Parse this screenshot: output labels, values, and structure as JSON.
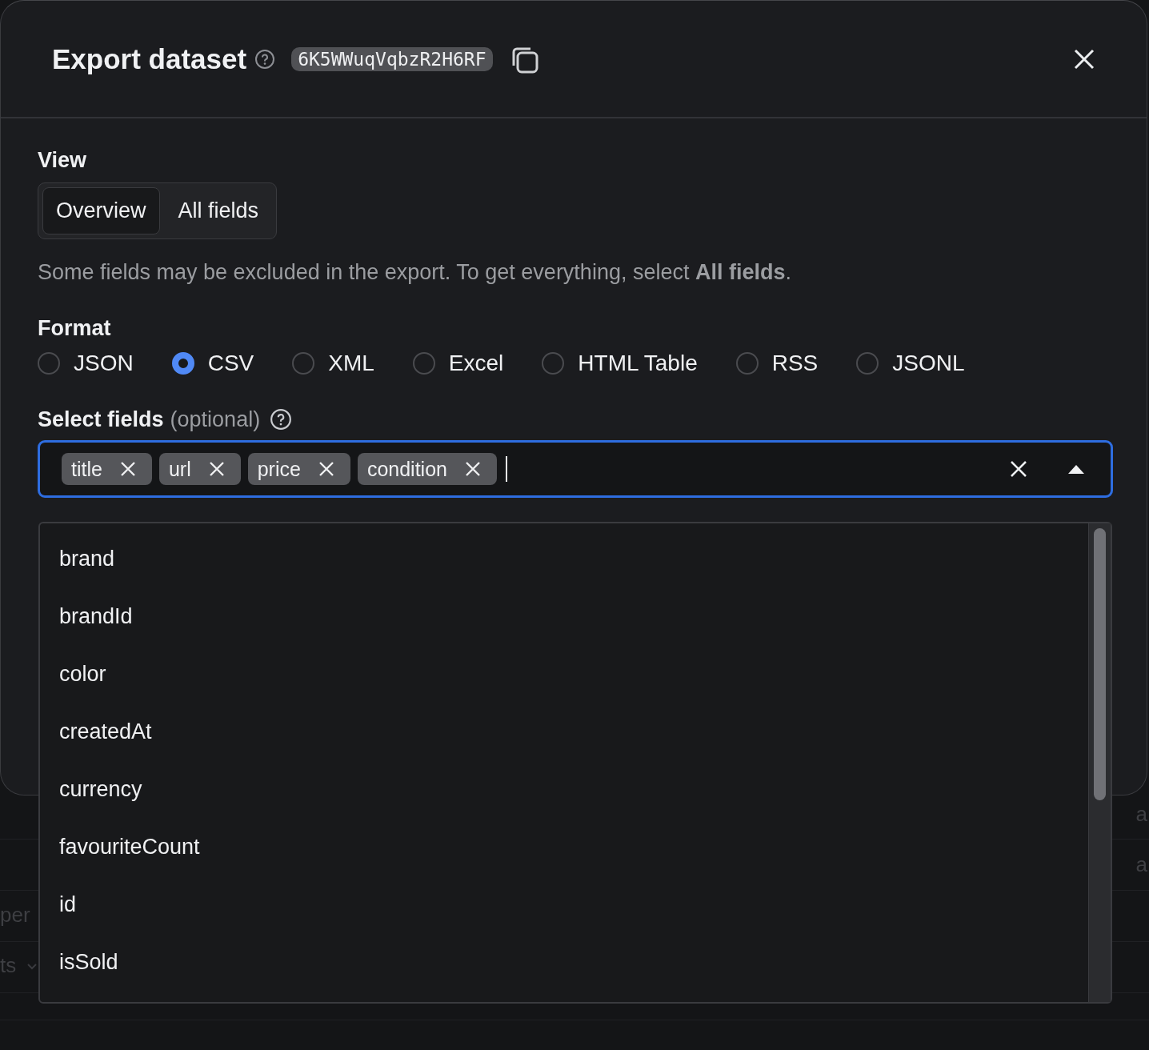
{
  "dialog": {
    "title": "Export dataset",
    "dataset_id": "6K5WWuqVqbzR2H6RF"
  },
  "view": {
    "label": "View",
    "options": [
      {
        "label": "Overview",
        "selected": true
      },
      {
        "label": "All fields",
        "selected": false
      }
    ],
    "hint": "Some fields may be excluded in the export. To get everything, select **All fields**."
  },
  "format": {
    "label": "Format",
    "options": [
      {
        "label": "JSON",
        "selected": false
      },
      {
        "label": "CSV",
        "selected": true
      },
      {
        "label": "XML",
        "selected": false
      },
      {
        "label": "Excel",
        "selected": false
      },
      {
        "label": "HTML Table",
        "selected": false
      },
      {
        "label": "RSS",
        "selected": false
      },
      {
        "label": "JSONL",
        "selected": false
      }
    ]
  },
  "select_fields": {
    "label": "Select fields",
    "optional": "(optional)",
    "chips": [
      "title",
      "url",
      "price",
      "condition"
    ],
    "options": [
      "brand",
      "brandId",
      "color",
      "createdAt",
      "currency",
      "favouriteCount",
      "id",
      "isSold"
    ]
  },
  "background": {
    "left_texts": [
      "per",
      "ts"
    ],
    "right_texts": [
      "a",
      "a"
    ]
  }
}
